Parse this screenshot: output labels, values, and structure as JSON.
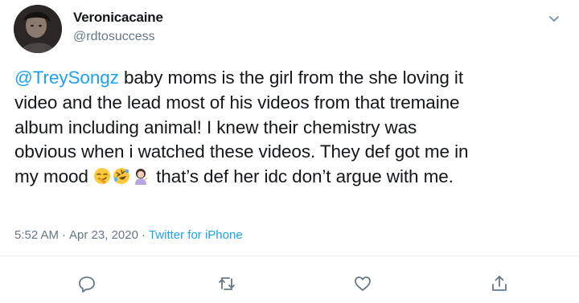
{
  "user": {
    "display_name": "Veronicacaine",
    "handle": "@rdtosuccess",
    "avatar_icon": "avatar-photo"
  },
  "tweet": {
    "mention": "@TreySongz",
    "line1_rest": " baby moms is the girl from the she loving it",
    "line2": "video and the lead most of his videos from that tremaine",
    "line3": "album including animal! I knew their chemistry was",
    "line4": "obvious when i watched these videos. They def got me in",
    "line5_start": "my mood ",
    "line5_end": " that’s def her idc don’t argue with me.",
    "emojis": [
      "smirking-face",
      "rolling-on-floor-laughing",
      "woman-tipping-hand"
    ]
  },
  "meta": {
    "time": "5:52 AM",
    "separator1": "·",
    "date": "Apr 23, 2020",
    "separator2": "·",
    "source": "Twitter for iPhone"
  },
  "actions": {
    "icons": [
      "reply-icon",
      "retweet-icon",
      "like-icon",
      "share-icon"
    ]
  },
  "colors": {
    "link": "#1da1f2",
    "secondary": "#657786",
    "text": "#14171a",
    "divider": "#e6ecf0"
  }
}
